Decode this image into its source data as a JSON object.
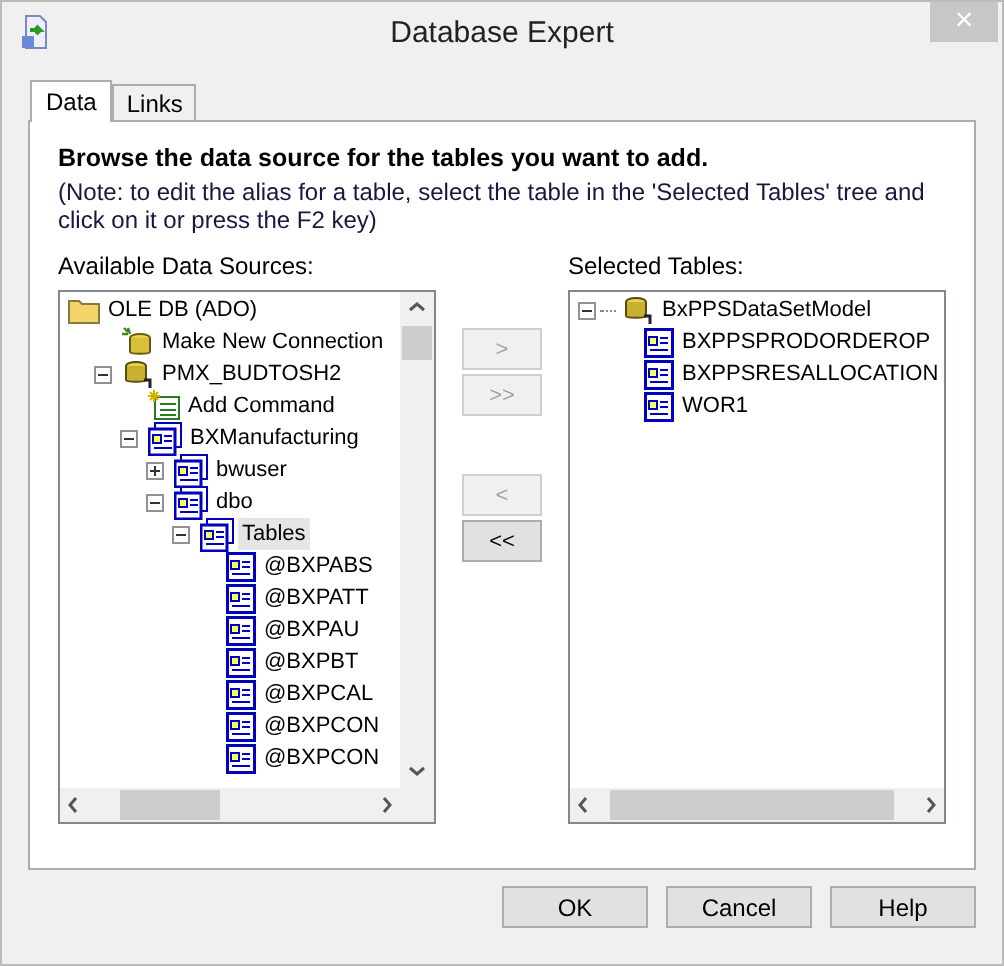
{
  "window": {
    "title": "Database Expert",
    "close": "×"
  },
  "tabs": [
    {
      "label": "Data",
      "selected": true
    },
    {
      "label": "Links",
      "selected": false
    }
  ],
  "heading": "Browse the data source for the tables you want to add.",
  "note": "(Note: to edit the alias for a table, select the table in the 'Selected Tables' tree and click on it or press the F2 key)",
  "available": {
    "label": "Available Data Sources:",
    "tree": [
      {
        "label": "OLE DB (ADO)",
        "kind": "folder",
        "selected": false,
        "children": [
          {
            "label": "Make New Connection",
            "kind": "new-connection",
            "selected": false
          },
          {
            "label": "PMX_BUDTOSH2",
            "kind": "server",
            "expanded": true,
            "selected": false,
            "children": [
              {
                "label": "Add Command",
                "kind": "command",
                "selected": false
              },
              {
                "label": "BXManufacturing",
                "kind": "database",
                "expanded": true,
                "selected": false,
                "children": [
                  {
                    "label": "bwuser",
                    "kind": "database",
                    "expanded": false,
                    "selected": false
                  },
                  {
                    "label": "dbo",
                    "kind": "database",
                    "expanded": true,
                    "selected": false,
                    "children": [
                      {
                        "label": "Tables",
                        "kind": "database",
                        "expanded": true,
                        "selected": true,
                        "children": [
                          {
                            "label": "@BXPABS",
                            "kind": "table",
                            "selected": false
                          },
                          {
                            "label": "@BXPATT",
                            "kind": "table",
                            "selected": false
                          },
                          {
                            "label": "@BXPAU",
                            "kind": "table",
                            "selected": false
                          },
                          {
                            "label": "@BXPBT",
                            "kind": "table",
                            "selected": false
                          },
                          {
                            "label": "@BXPCAL",
                            "kind": "table",
                            "selected": false
                          },
                          {
                            "label": "@BXPCON",
                            "kind": "table",
                            "selected": false
                          },
                          {
                            "label": "@BXPCON",
                            "kind": "table",
                            "selected": false
                          }
                        ]
                      }
                    ]
                  }
                ]
              }
            ]
          }
        ]
      }
    ]
  },
  "move_buttons": [
    {
      "label": ">",
      "disabled": true
    },
    {
      "label": ">>",
      "disabled": true
    },
    {
      "label": "<",
      "disabled": true
    },
    {
      "label": "<<",
      "disabled": false
    }
  ],
  "selected_tables": {
    "label": "Selected Tables:",
    "tree": [
      {
        "label": "BxPPSDataSetModel",
        "kind": "server",
        "expanded": true,
        "selected": false,
        "children": [
          {
            "label": "BXPPSPRODORDEROP",
            "kind": "table",
            "selected": false
          },
          {
            "label": "BXPPSRESALLOCATION",
            "kind": "table",
            "selected": false
          },
          {
            "label": "WOR1",
            "kind": "table",
            "selected": false
          }
        ]
      }
    ]
  },
  "buttons": [
    {
      "label": "OK"
    },
    {
      "label": "Cancel"
    },
    {
      "label": "Help"
    }
  ]
}
